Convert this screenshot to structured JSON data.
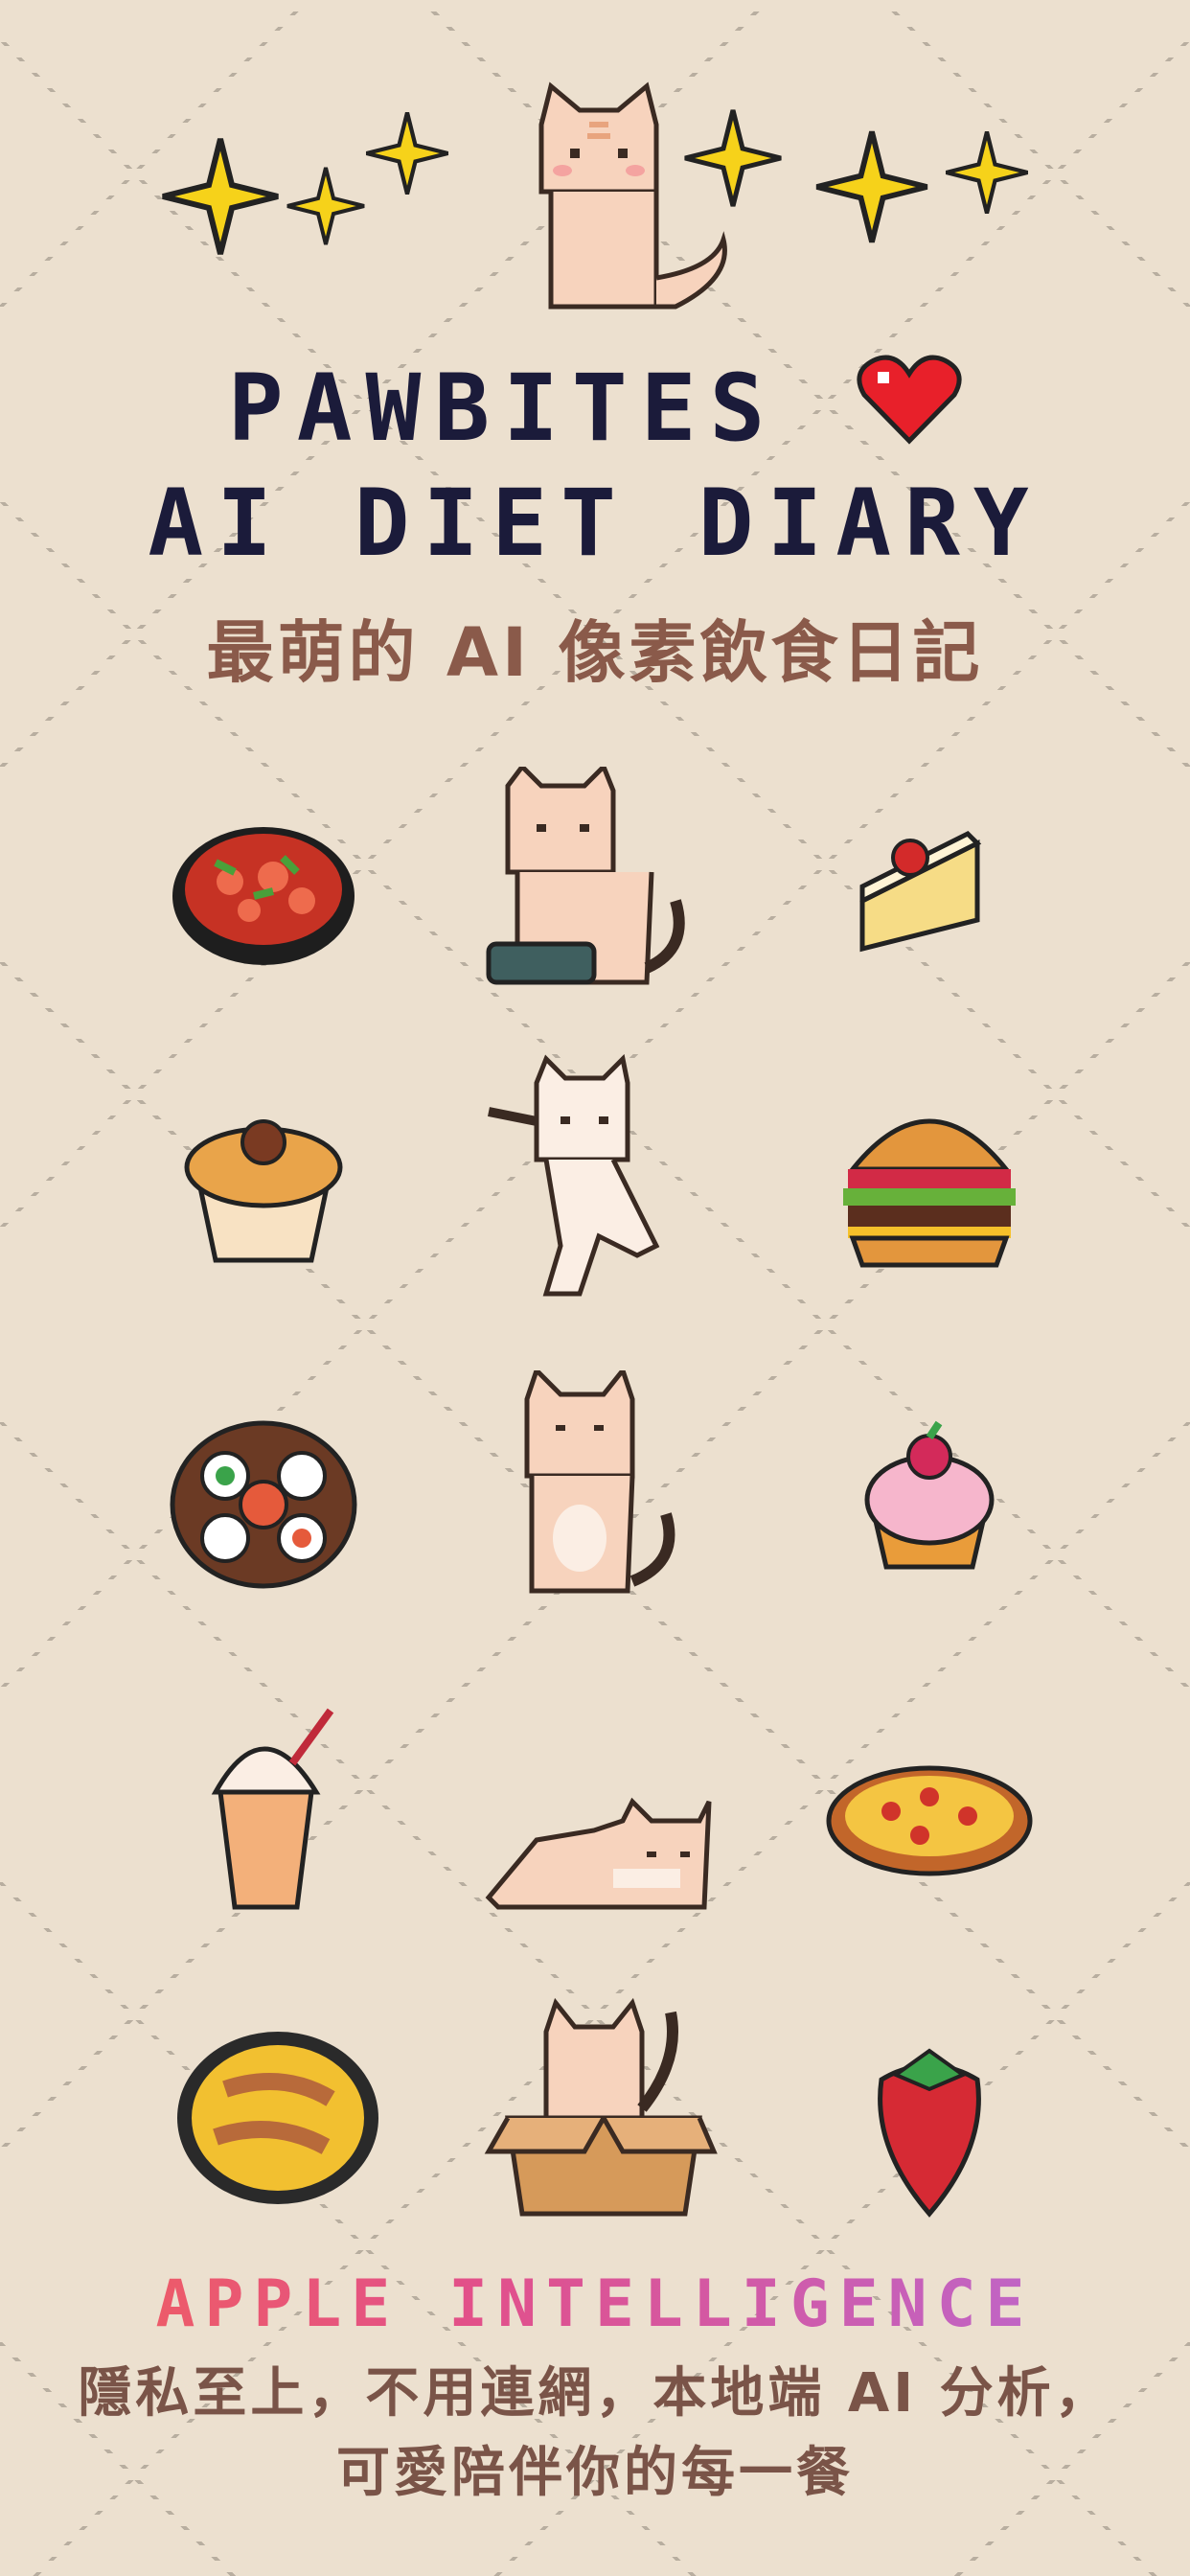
{
  "header": {
    "title_line1": "PAWBITES",
    "title_line2": "AI DIET DIARY",
    "subtitle": "最萌的 AI 像素飲食日記"
  },
  "footer": {
    "brand": "APPLE INTELLIGENCE",
    "line1": "隱私至上，不用連網，本地端 AI 分析，",
    "line2": "可愛陪伴你的每一餐"
  },
  "colors": {
    "background": "#ece0cf",
    "title": "#1b1b3a",
    "subtitle": "#8a5a4a",
    "heart": "#e8202a",
    "sparkle": "#f6d21a",
    "cat": "#f7d3bd"
  },
  "grid": [
    [
      "hotpot-icon",
      "cat-eating-icon",
      "cheesecake-icon"
    ],
    [
      "muffin-icon",
      "cat-dancing-icon",
      "burger-icon"
    ],
    [
      "sushi-platter-icon",
      "cat-praying-icon",
      "cupcake-icon"
    ],
    [
      "milkshake-icon",
      "cat-lying-icon",
      "pizza-icon"
    ],
    [
      "omelette-icon",
      "cat-in-box-icon",
      "strawberry-icon"
    ]
  ]
}
